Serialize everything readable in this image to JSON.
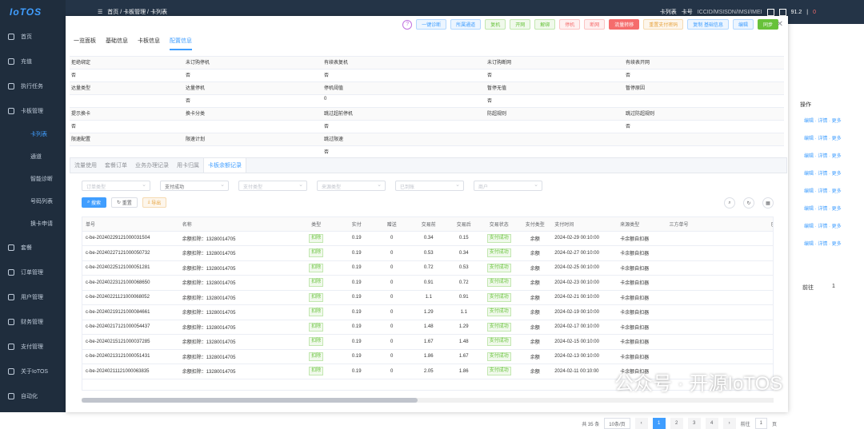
{
  "app": {
    "logo": "IoTOS"
  },
  "sidebar": {
    "items": [
      {
        "name": "sidebar-item-home",
        "label": "首页",
        "sub": false,
        "active": false
      },
      {
        "name": "sidebar-item-recharge",
        "label": "充值",
        "sub": false,
        "active": false
      },
      {
        "name": "sidebar-item-tasks",
        "label": "执行任务",
        "sub": false,
        "active": false
      },
      {
        "name": "sidebar-item-card-mgmt",
        "label": "卡板管理",
        "sub": false,
        "active": false
      },
      {
        "name": "sidebar-item-card-list",
        "label": "卡列表",
        "sub": true,
        "active": true
      },
      {
        "name": "sidebar-item-channel",
        "label": "通道",
        "sub": true,
        "active": false
      },
      {
        "name": "sidebar-item-smart-diag",
        "label": "智能诊断",
        "sub": true,
        "active": false
      },
      {
        "name": "sidebar-item-number-list",
        "label": "号码列表",
        "sub": true,
        "active": false
      },
      {
        "name": "sidebar-item-swap-apply",
        "label": "换卡申请",
        "sub": true,
        "active": false
      },
      {
        "name": "sidebar-item-package",
        "label": "套餐",
        "sub": false,
        "active": false
      },
      {
        "name": "sidebar-item-orders",
        "label": "订单管理",
        "sub": false,
        "active": false
      },
      {
        "name": "sidebar-item-users",
        "label": "用户管理",
        "sub": false,
        "active": false
      },
      {
        "name": "sidebar-item-finance",
        "label": "财务管理",
        "sub": false,
        "active": false
      },
      {
        "name": "sidebar-item-payment",
        "label": "支付管理",
        "sub": false,
        "active": false
      },
      {
        "name": "sidebar-item-about",
        "label": "关于IoTOS",
        "sub": false,
        "active": false
      },
      {
        "name": "sidebar-item-automation",
        "label": "自动化",
        "sub": false,
        "active": false
      }
    ]
  },
  "topbar": {
    "breadcrumb": "首页 / 卡板管理 / 卡列表",
    "select1": "卡列表",
    "select2": "卡号",
    "search": "ICCID/MSISDN/IMSI/IMEI",
    "balance": "91.2",
    "sep": "|",
    "zero": "0"
  },
  "bg": {
    "ops_header": "操作",
    "ops_row": "编辑 · 详情 · 更多",
    "per_page_label": "前往",
    "page": "1"
  },
  "modal": {
    "actions": [
      {
        "label": "一键诊断",
        "style": ""
      },
      {
        "label": "所属通道",
        "style": ""
      },
      {
        "label": "复机",
        "style": "g"
      },
      {
        "label": "开网",
        "style": "g"
      },
      {
        "label": "解绑",
        "style": "g"
      },
      {
        "label": "停机",
        "style": "r"
      },
      {
        "label": "断网",
        "style": "r"
      },
      {
        "label": "流量转移",
        "style": "rs"
      },
      {
        "label": "重置支付密码",
        "style": "y"
      },
      {
        "label": "复制 基础信息",
        "style": ""
      },
      {
        "label": "编辑",
        "style": ""
      },
      {
        "label": "同步",
        "style": "gs"
      }
    ],
    "tabs": [
      {
        "label": "一览面板",
        "active": false
      },
      {
        "label": "基础信息",
        "active": false
      },
      {
        "label": "卡板信息",
        "active": false
      },
      {
        "label": "配置信息",
        "active": true
      }
    ],
    "info": [
      [
        "拒绝绑定",
        "未订购停机",
        "有续表复机",
        "未订购断网",
        "有续表开网"
      ],
      [
        "否",
        "否",
        "否",
        "否",
        "否"
      ],
      [
        "达量类型",
        "达量停机",
        "停机阈值",
        "暂停无值",
        "暂停原因"
      ],
      [
        "",
        "否",
        "0",
        "否",
        ""
      ],
      [
        "提示换卡",
        "换卡分类",
        "跳过超前停机",
        "防超规则",
        "跳过防超规则"
      ],
      [
        "否",
        "",
        "否",
        "",
        "否"
      ],
      [
        "限速配置",
        "限速计划",
        "跳过限速",
        "",
        ""
      ],
      [
        "",
        "",
        "否",
        "",
        ""
      ]
    ],
    "subtabs": [
      {
        "label": "流量使用",
        "active": false
      },
      {
        "label": "套餐订单",
        "active": false
      },
      {
        "label": "业务办理记录",
        "active": false
      },
      {
        "label": "用卡归属",
        "active": false
      },
      {
        "label": "卡板余额记录",
        "active": true
      }
    ],
    "filters": [
      {
        "text": "订单类型",
        "val": false
      },
      {
        "text": "支付成功",
        "val": true
      },
      {
        "text": "支付类型",
        "val": false
      },
      {
        "text": "来源类型",
        "val": false
      },
      {
        "text": "已到账",
        "val": false
      },
      {
        "text": "商户",
        "val": false
      }
    ],
    "buttons": {
      "search": "搜索",
      "reset": "重置",
      "export": "导出"
    },
    "table": {
      "headers": [
        "单号",
        "名称",
        "类型",
        "实付",
        "赠送",
        "交易前",
        "交易后",
        "交易状态",
        "支付类型",
        "支付时间",
        "来源类型",
        "三方单号",
        "已到账"
      ],
      "rows": [
        [
          "c-be-20240229121000031504",
          "余额扣除：13280014705",
          "扣除",
          "0.19",
          "0",
          "0.34",
          "0.15",
          "支付成功",
          "余额",
          "2024-02-29 00:10:00",
          "卡余额自扣器",
          "",
          "否"
        ],
        [
          "c-be-20240227121000050732",
          "余额扣除：13280014705",
          "扣除",
          "0.19",
          "0",
          "0.53",
          "0.34",
          "支付成功",
          "余额",
          "2024-02-27 00:10:00",
          "卡余额自扣器",
          "",
          "否"
        ],
        [
          "c-be-20240225121000051281",
          "余额扣除：13280014705",
          "扣除",
          "0.19",
          "0",
          "0.72",
          "0.53",
          "支付成功",
          "余额",
          "2024-02-25 00:10:00",
          "卡余额自扣器",
          "",
          "否"
        ],
        [
          "c-be-20240223121000068650",
          "余额扣除：13280014705",
          "扣除",
          "0.19",
          "0",
          "0.91",
          "0.72",
          "支付成功",
          "余额",
          "2024-02-23 00:10:00",
          "卡余额自扣器",
          "",
          "否"
        ],
        [
          "c-be-20240221121000068052",
          "余额扣除：13280014705",
          "扣除",
          "0.19",
          "0",
          "1.1",
          "0.91",
          "支付成功",
          "余额",
          "2024-02-21 00:10:00",
          "卡余额自扣器",
          "",
          "否"
        ],
        [
          "c-be-20240219121000084661",
          "余额扣除：13280014705",
          "扣除",
          "0.19",
          "0",
          "1.29",
          "1.1",
          "支付成功",
          "余额",
          "2024-02-19 00:10:00",
          "卡余额自扣器",
          "",
          "否"
        ],
        [
          "c-be-20240217121000054437",
          "余额扣除：13280014705",
          "扣除",
          "0.19",
          "0",
          "1.48",
          "1.29",
          "支付成功",
          "余额",
          "2024-02-17 00:10:00",
          "卡余额自扣器",
          "",
          "否"
        ],
        [
          "c-be-20240215121000037285",
          "余额扣除：13280014705",
          "扣除",
          "0.19",
          "0",
          "1.67",
          "1.48",
          "支付成功",
          "余额",
          "2024-02-15 00:10:00",
          "卡余额自扣器",
          "",
          "否"
        ],
        [
          "c-be-20240213121000051431",
          "余额扣除：13280014705",
          "扣除",
          "0.19",
          "0",
          "1.86",
          "1.67",
          "支付成功",
          "余额",
          "2024-02-13 00:10:00",
          "卡余额自扣器",
          "",
          "否"
        ],
        [
          "c-be-20240211121000063835",
          "余额扣除：13280014705",
          "扣除",
          "0.19",
          "0",
          "2.05",
          "1.86",
          "支付成功",
          "余额",
          "2024-02-11 00:10:00",
          "卡余额自扣器",
          "",
          "否"
        ]
      ]
    },
    "pagination": {
      "total": "共 35 条",
      "per_page": "10条/页",
      "pages": [
        "1",
        "2",
        "3",
        "4"
      ],
      "active": "1",
      "goto_label": "前往",
      "goto_value": "1",
      "page_unit": "页"
    }
  },
  "watermark": "公众号 · 开源IoTOS"
}
